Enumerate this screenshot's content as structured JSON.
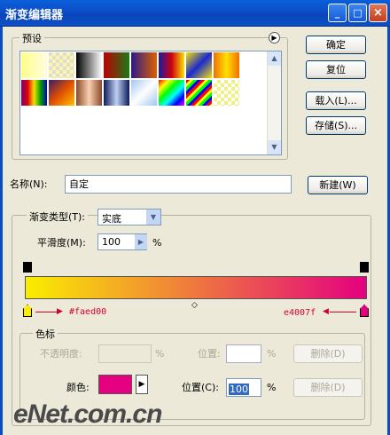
{
  "window": {
    "title": "渐变编辑器",
    "minimize": "_",
    "maximize": "□",
    "close": "×"
  },
  "presets": {
    "label": "预设",
    "menu_icon": "circle-arrow-right-icon",
    "swatch_count": 18
  },
  "buttons": {
    "ok": "确定",
    "reset": "复位",
    "load": "载入(L)...",
    "save": "存储(S)...",
    "new": "新建(W)"
  },
  "name": {
    "label": "名称(N):",
    "value": "自定"
  },
  "gradient": {
    "type_label": "渐变类型(T):",
    "type_value": "实底",
    "smoothness_label": "平滑度(M):",
    "smoothness_value": "100",
    "smoothness_unit": "%",
    "color_stops": [
      {
        "position_percent": 0,
        "color": "#faed00"
      },
      {
        "position_percent": 100,
        "color": "#e4007f"
      }
    ],
    "annotations": {
      "left": "#faed00",
      "right": "e4007f"
    }
  },
  "stops": {
    "label": "色标",
    "opacity_label": "不透明度:",
    "opacity_unit": "%",
    "opacity_location_label": "位置:",
    "opacity_location_unit": "%",
    "opacity_delete": "删除(D)",
    "color_label": "颜色:",
    "color_value": "#e4007f",
    "color_location_label": "位置(C):",
    "color_location_value": "100",
    "color_location_unit": "%",
    "color_delete": "删除(D)"
  },
  "watermark": {
    "text": "eNet.com.cn"
  }
}
